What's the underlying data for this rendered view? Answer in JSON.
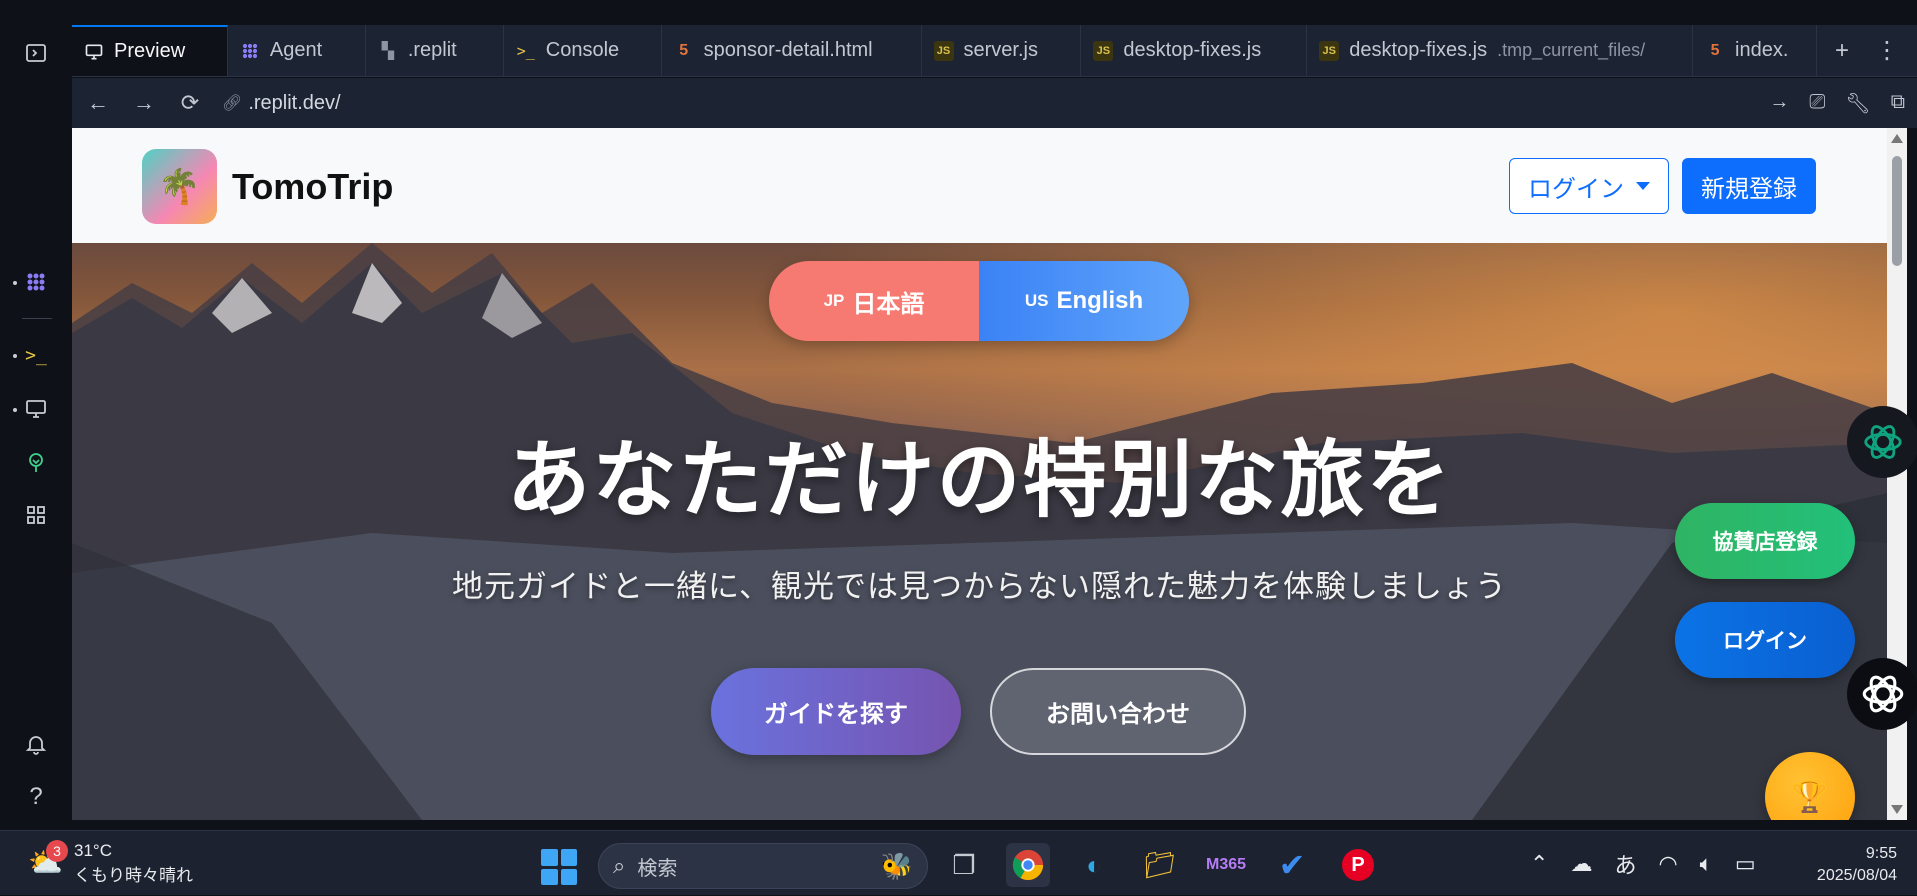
{
  "tabs": [
    {
      "label": "Preview",
      "icon": "monitor-icon",
      "active": true
    },
    {
      "label": "Agent",
      "icon": "agent-icon"
    },
    {
      "label": ".replit",
      "icon": "config-icon"
    },
    {
      "label": "Console",
      "icon": "terminal-icon"
    },
    {
      "label": "sponsor-detail.html",
      "icon": "html-file-icon"
    },
    {
      "label": "server.js",
      "icon": "js-file-icon"
    },
    {
      "label": "desktop-fixes.js",
      "icon": "js-file-icon"
    },
    {
      "label": "desktop-fixes.js",
      "sub": ".tmp_current_files/",
      "icon": "js-file-icon"
    },
    {
      "label": "index.",
      "icon": "html-file-icon"
    }
  ],
  "urlbar": {
    "url": ".replit.dev/"
  },
  "site": {
    "brand": "TomoTrip",
    "login_label": "ログイン",
    "signup_label": "新規登録",
    "lang_ja_code": "JP",
    "lang_ja_label": "日本語",
    "lang_en_code": "US",
    "lang_en_label": "English",
    "hero_title": "あなただけの特別な旅を",
    "hero_subtitle": "地元ガイドと一緒に、観光では見つからない隠れた魅力を体験しましょう",
    "btn_find_guide": "ガイドを探す",
    "btn_contact": "お問い合わせ",
    "fab_sponsor": "協賛店登録",
    "fab_login": "ログイン"
  },
  "taskbar": {
    "weather_badge": "3",
    "weather_temp": "31°C",
    "weather_desc": "くもり時々晴れ",
    "search_placeholder": "検索",
    "ime_label": "あ",
    "time": "9:55",
    "date": "2025/08/04"
  },
  "colors": {
    "accent": "#0d6efd",
    "lang_ja": "#f77a72",
    "lang_en": "#3b82f6",
    "sponsor_green": "#2fb463",
    "trophy_orange": "#ff9f0a"
  }
}
